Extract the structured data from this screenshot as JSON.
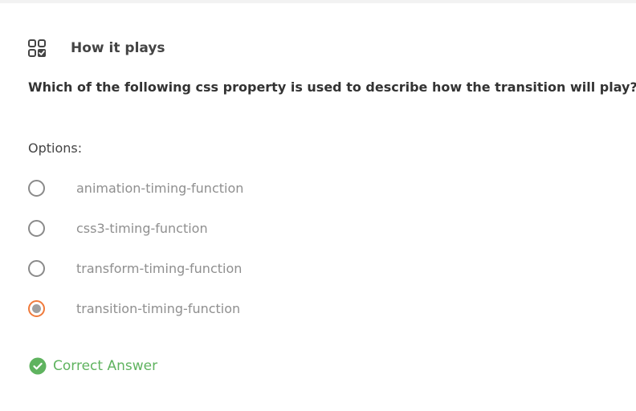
{
  "header": {
    "icon": "grid-check-icon",
    "title": "How it plays"
  },
  "question": {
    "text": "Which of the following css property is used to describe how the transition will play?"
  },
  "options": {
    "label": "Options:",
    "items": [
      {
        "label": "animation-timing-function",
        "selected": false
      },
      {
        "label": "css3-timing-function",
        "selected": false
      },
      {
        "label": "transform-timing-function",
        "selected": false
      },
      {
        "label": "transition-timing-function",
        "selected": true
      }
    ]
  },
  "feedback": {
    "icon": "check-circle-icon",
    "text": "Correct Answer",
    "color": "#5fb35f"
  },
  "colors": {
    "accent": "#f07a3b",
    "correct": "#5fb35f"
  }
}
